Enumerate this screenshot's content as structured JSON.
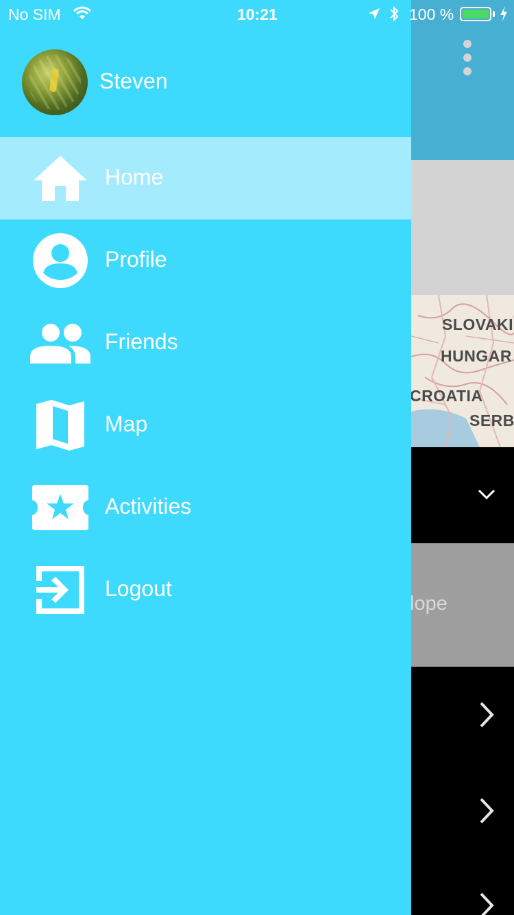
{
  "status_bar": {
    "carrier": "No SIM",
    "time": "10:21",
    "battery_percent": "100 %",
    "battery_level": 1.0
  },
  "drawer": {
    "user_name": "Steven",
    "menu": [
      {
        "label": "Home",
        "icon": "home-icon",
        "active": true
      },
      {
        "label": "Profile",
        "icon": "account-circle-icon",
        "active": false
      },
      {
        "label": "Friends",
        "icon": "people-icon",
        "active": false
      },
      {
        "label": "Map",
        "icon": "map-icon",
        "active": false
      },
      {
        "label": "Activities",
        "icon": "ticket-star-icon",
        "active": false
      },
      {
        "label": "Logout",
        "icon": "exit-icon",
        "active": false
      }
    ]
  },
  "background_screen": {
    "map_labels": [
      "SLOVAKI",
      "HUNGAR",
      "CROATIA",
      "SERB"
    ],
    "slope_text": "lope"
  },
  "colors": {
    "drawer": "#3ddafd",
    "active_item": "#a4ebfd",
    "header": "#46afd2"
  }
}
